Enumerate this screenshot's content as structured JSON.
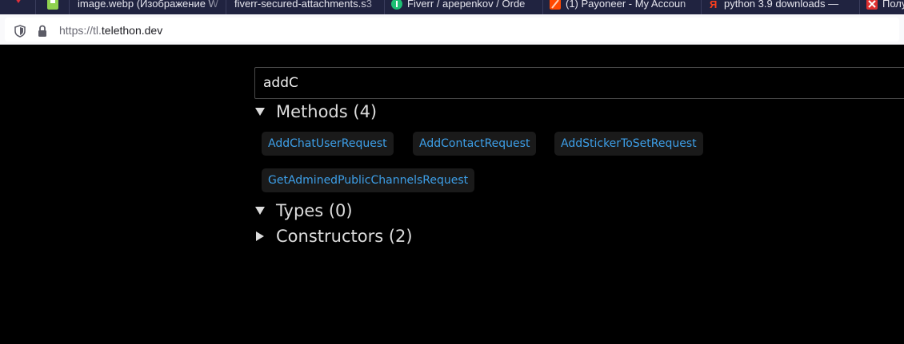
{
  "browser": {
    "tabs": [
      {
        "label": "",
        "icon": "pin-icon"
      },
      {
        "label": "",
        "icon": "app-icon"
      },
      {
        "label": "image.webp (Изображение W",
        "icon": ""
      },
      {
        "label": "fiverr-secured-attachments.s3",
        "icon": ""
      },
      {
        "label": "Fiverr / apepenkov / Orde",
        "icon": "fiverr-icon"
      },
      {
        "label": "(1) Payoneer - My Accoun",
        "icon": "payoneer-icon"
      },
      {
        "label": "python 3.9 downloads —",
        "icon": "yandex-icon"
      },
      {
        "label": "Получ",
        "icon": "close-icon"
      }
    ],
    "url_prefix": "https://tl.",
    "url_domain": "telethon.dev"
  },
  "search": {
    "value": "addC",
    "placeholder": ""
  },
  "sections": {
    "methods": {
      "label": "Methods (4)",
      "expanded": true
    },
    "types": {
      "label": "Types (0)",
      "expanded": true
    },
    "constructors": {
      "label": "Constructors (2)",
      "expanded": false
    }
  },
  "results": {
    "methods": [
      "AddChatUserRequest",
      "AddContactRequest",
      "AddStickerToSetRequest",
      "GetAdminedPublicChannelsRequest"
    ]
  },
  "colors": {
    "background": "#000000",
    "link": "#3d9fe8",
    "chip_background": "#1a1a1a",
    "heading": "#dcdcdc",
    "tab_strip": "#202340"
  }
}
